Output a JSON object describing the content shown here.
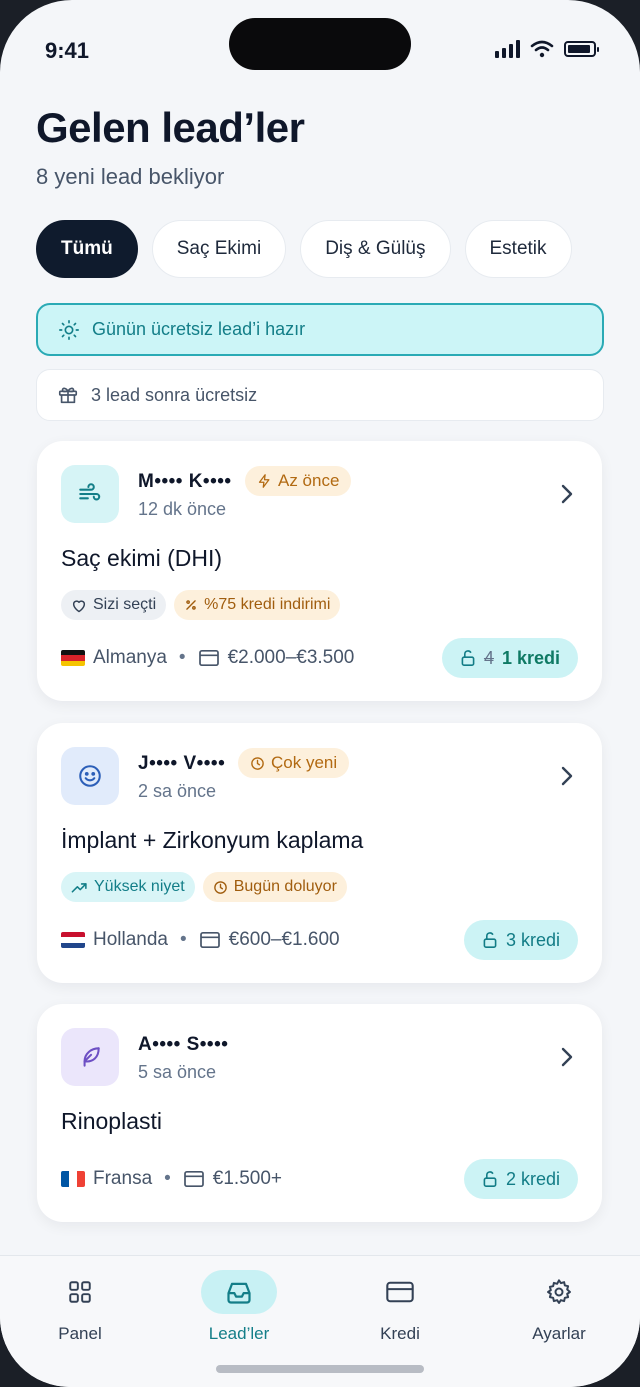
{
  "status": {
    "time": "9:41"
  },
  "header": {
    "title": "Gelen lead’ler",
    "subtitle": "8 yeni lead bekliyor"
  },
  "filters": [
    {
      "label": "Tümü",
      "active": true
    },
    {
      "label": "Saç Ekimi"
    },
    {
      "label": "Diş & Gülüş"
    },
    {
      "label": "Estetik"
    }
  ],
  "banners": {
    "free": "Günün ücretsiz lead’i hazır",
    "gift": "3 lead sonra ücretsiz"
  },
  "leads": [
    {
      "name": "M•••• K••••",
      "time": "12 dk önce",
      "tag": "Az önce",
      "service": "Saç ekimi (DHI)",
      "pills": [
        "Sizi seçti",
        "%75 kredi indirimi"
      ],
      "country": "Almanya",
      "budget": "€2.000–€3.500",
      "credit_old": "4",
      "credit": "1 kredi",
      "icon": "wind-icon"
    },
    {
      "name": "J•••• V••••",
      "time": "2 sa önce",
      "tag": "Çok yeni",
      "service": "İmplant + Zirkonyum kaplama",
      "pills": [
        "Yüksek niyet",
        "Bugün doluyor"
      ],
      "country": "Hollanda",
      "budget": "€600–€1.600",
      "credit": "3 kredi",
      "icon": "smile-icon"
    },
    {
      "name": "A•••• S••••",
      "time": "5 sa önce",
      "service": "Rinoplasti",
      "country": "Fransa",
      "budget": "€1.500+",
      "credit": "2 kredi",
      "icon": "feather-icon"
    }
  ],
  "tabbar": [
    {
      "label": "Panel"
    },
    {
      "label": "Lead’ler",
      "active": true
    },
    {
      "label": "Kredi"
    },
    {
      "label": "Ayarlar"
    }
  ],
  "colors": {
    "accent": "#137e88",
    "dark": "#0f1b2d",
    "badge": "#fdf0dc"
  }
}
